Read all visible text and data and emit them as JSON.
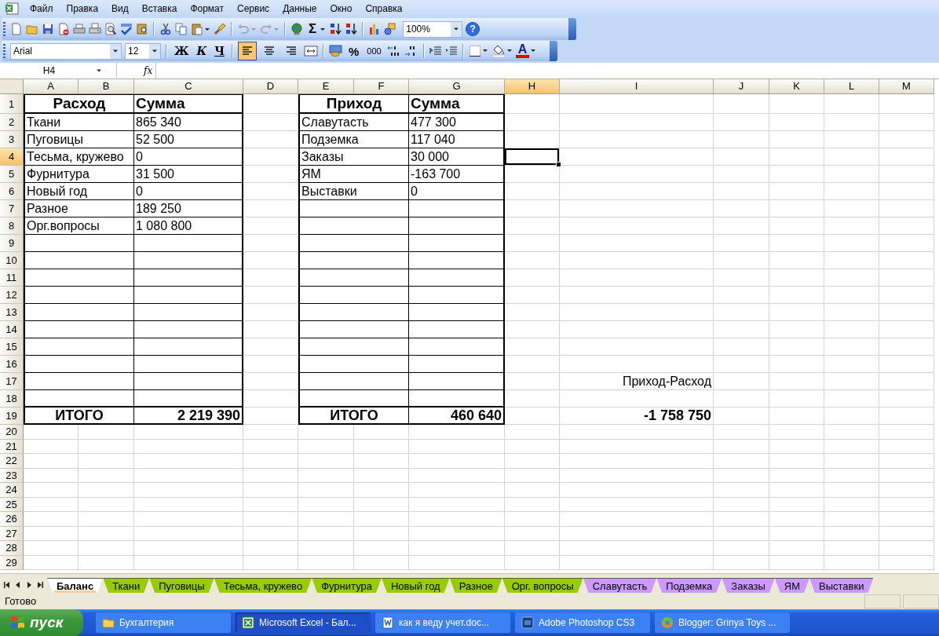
{
  "menu": [
    "Файл",
    "Правка",
    "Вид",
    "Вставка",
    "Формат",
    "Сервис",
    "Данные",
    "Окно",
    "Справка"
  ],
  "standard_toolbar": {
    "autosum": "Σ",
    "zoom": "100%",
    "help": "?"
  },
  "formatting_toolbar": {
    "font": "Arial",
    "size": "12",
    "bold": "Ж",
    "italic": "К",
    "underline": "Ч",
    "align": [
      {
        "kind": "left",
        "selected": true
      },
      {
        "kind": "center",
        "selected": false
      },
      {
        "kind": "right",
        "selected": false
      }
    ],
    "percent": "%",
    "thousands": "000",
    "font_color": "A"
  },
  "formula_bar": {
    "name_box": "H4",
    "fx": "fx"
  },
  "sheet": {
    "columns": [
      {
        "label": "A",
        "selected": false
      },
      {
        "label": "B",
        "selected": false
      },
      {
        "label": "C",
        "selected": false
      },
      {
        "label": "D",
        "selected": false
      },
      {
        "label": "E",
        "selected": false
      },
      {
        "label": "F",
        "selected": false
      },
      {
        "label": "G",
        "selected": false
      },
      {
        "label": "H",
        "selected": true
      },
      {
        "label": "I",
        "selected": false
      },
      {
        "label": "J",
        "selected": false
      },
      {
        "label": "K",
        "selected": false
      },
      {
        "label": "L",
        "selected": false
      },
      {
        "label": "M",
        "selected": false
      }
    ],
    "rows": [
      {
        "label": "1",
        "selected": false
      },
      {
        "label": "2",
        "selected": false
      },
      {
        "label": "3",
        "selected": false
      },
      {
        "label": "4",
        "selected": true
      },
      {
        "label": "5",
        "selected": false
      },
      {
        "label": "6",
        "selected": false
      },
      {
        "label": "7",
        "selected": false
      },
      {
        "label": "8",
        "selected": false
      },
      {
        "label": "9",
        "selected": false
      },
      {
        "label": "10",
        "selected": false
      },
      {
        "label": "11",
        "selected": false
      },
      {
        "label": "12",
        "selected": false
      },
      {
        "label": "13",
        "selected": false
      },
      {
        "label": "14",
        "selected": false
      },
      {
        "label": "15",
        "selected": false
      },
      {
        "label": "16",
        "selected": false
      },
      {
        "label": "17",
        "selected": false
      },
      {
        "label": "18",
        "selected": false
      },
      {
        "label": "19",
        "selected": false
      },
      {
        "label": "20",
        "selected": false
      },
      {
        "label": "21",
        "selected": false
      },
      {
        "label": "22",
        "selected": false
      },
      {
        "label": "23",
        "selected": false
      },
      {
        "label": "24",
        "selected": false
      },
      {
        "label": "25",
        "selected": false
      },
      {
        "label": "26",
        "selected": false
      },
      {
        "label": "27",
        "selected": false
      },
      {
        "label": "28",
        "selected": false
      },
      {
        "label": "29",
        "selected": false
      }
    ],
    "expense_table": {
      "headers": [
        "Расход",
        "Сумма"
      ],
      "rows": [
        [
          "Ткани",
          "865 340"
        ],
        [
          "Пуговицы",
          "52 500"
        ],
        [
          "Тесьма, кружево",
          "0"
        ],
        [
          "Фурнитура",
          "31 500"
        ],
        [
          "Новый год",
          "0"
        ],
        [
          "Разное",
          "189 250"
        ],
        [
          "Орг.вопросы",
          "1 080 800"
        ]
      ],
      "total": [
        "ИТОГО",
        "2 219 390"
      ]
    },
    "income_table": {
      "headers": [
        "Приход",
        "Сумма"
      ],
      "rows": [
        [
          "Славутасть",
          "477 300"
        ],
        [
          "Подземка",
          "117 040"
        ],
        [
          "Заказы",
          "30 000"
        ],
        [
          "ЯМ",
          "-163 700"
        ],
        [
          "Выставки",
          "0"
        ]
      ],
      "total": [
        "ИТОГО",
        "460 640"
      ]
    },
    "balance": {
      "label": "Приход-Расход",
      "value": "-1 758 750"
    }
  },
  "sheet_tabs": [
    {
      "label": "Баланс",
      "selected": true,
      "color": "#ffcc99"
    },
    {
      "label": "Ткани",
      "selected": false,
      "color": "#99cc00"
    },
    {
      "label": "Пуговицы",
      "selected": false,
      "color": "#99cc00"
    },
    {
      "label": "Тесьма, кружево",
      "selected": false,
      "color": "#99cc00"
    },
    {
      "label": "Фурнитура",
      "selected": false,
      "color": "#99cc00"
    },
    {
      "label": "Новый год",
      "selected": false,
      "color": "#99cc00"
    },
    {
      "label": "Разное",
      "selected": false,
      "color": "#99cc00"
    },
    {
      "label": "Орг. вопросы",
      "selected": false,
      "color": "#99cc00"
    },
    {
      "label": "Славутасть",
      "selected": false,
      "color": "#cc99ff"
    },
    {
      "label": "Подземка",
      "selected": false,
      "color": "#cc99ff"
    },
    {
      "label": "Заказы",
      "selected": false,
      "color": "#cc99ff"
    },
    {
      "label": "ЯМ",
      "selected": false,
      "color": "#cc99ff"
    },
    {
      "label": "Выставки",
      "selected": false,
      "color": "#cc99ff"
    }
  ],
  "status_bar": {
    "text": "Готово"
  },
  "taskbar": {
    "start": "пуск",
    "tasks": [
      {
        "label": "Бухгалтерия",
        "kind": "folder",
        "selected": false
      },
      {
        "label": "Microsoft Excel - Бал...",
        "kind": "excel",
        "selected": true
      },
      {
        "label": "как я веду учет.doc...",
        "kind": "word",
        "selected": false
      },
      {
        "label": "Adobe Photoshop CS3",
        "kind": "photoshop",
        "selected": false
      },
      {
        "label": "Blogger: Grinya Toys ...",
        "kind": "browser",
        "selected": false
      }
    ]
  }
}
